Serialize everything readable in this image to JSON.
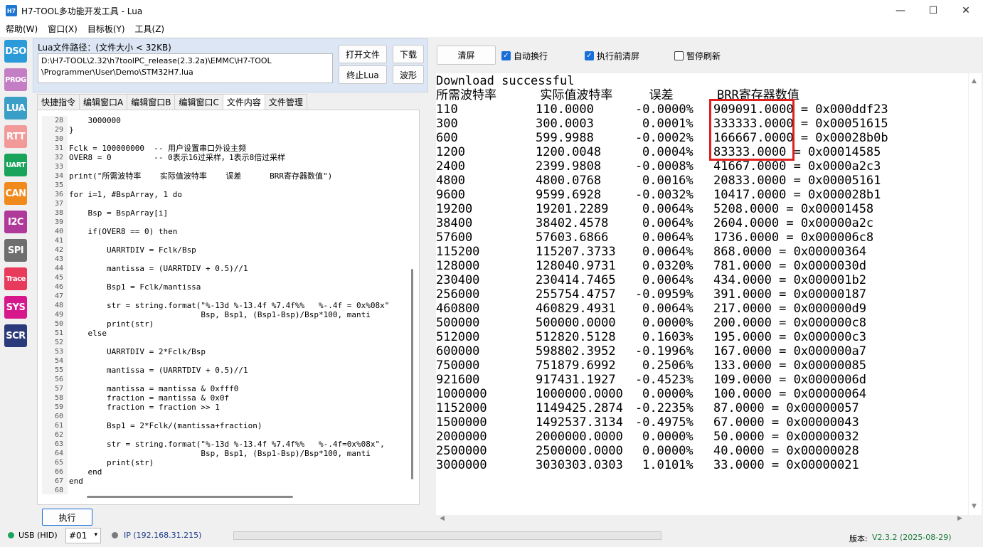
{
  "window": {
    "app_icon_text": "H7",
    "title": "H7-TOOL多功能开发工具 - Lua",
    "minimize": "—",
    "maximize": "☐",
    "close": "✕"
  },
  "menu": [
    "帮助(W)",
    "窗口(X)",
    "目标板(Y)",
    "工具(Z)"
  ],
  "tools": [
    {
      "label": "DSO",
      "color": "#2a9ad8"
    },
    {
      "label": "PROG",
      "color": "#c47ec4"
    },
    {
      "label": "LUA",
      "color": "#3a9ec6"
    },
    {
      "label": "RTT",
      "color": "#f29a9a"
    },
    {
      "label": "UART",
      "color": "#1aa35a"
    },
    {
      "label": "CAN",
      "color": "#f08a1c"
    },
    {
      "label": "I2C",
      "color": "#b03a9a"
    },
    {
      "label": "SPI",
      "color": "#6e6e6e"
    },
    {
      "label": "Trace",
      "color": "#e83a5a"
    },
    {
      "label": "SYS",
      "color": "#d6188c"
    },
    {
      "label": "SCR",
      "color": "#2a3a7a"
    }
  ],
  "lua_panel": {
    "path_label": "Lua文件路径：(文件大小 < 32KB)",
    "path_line1": "D:\\H7-TOOL\\2.32\\h7toolPC_release(2.3.2a)\\EMMC\\H7-TOOL",
    "path_line2": "\\Programmer\\User\\Demo\\STM32H7.lua",
    "open_btn": "打开文件",
    "download_btn": "下载",
    "stop_btn": "终止Lua",
    "wave_btn": "波形"
  },
  "tabs": [
    "快捷指令",
    "编辑窗口A",
    "编辑窗口B",
    "编辑窗口C",
    "文件内容",
    "文件管理"
  ],
  "active_tab": 4,
  "editor_lines": [
    {
      "n": "28",
      "t": "    3000000"
    },
    {
      "n": "29",
      "t": "}"
    },
    {
      "n": "30",
      "t": ""
    },
    {
      "n": "31",
      "t": "Fclk = 100000000  -- 用户设置串口外设主频"
    },
    {
      "n": "32",
      "t": "OVER8 = 0         -- 0表示16过采样，1表示8倍过采样"
    },
    {
      "n": "33",
      "t": ""
    },
    {
      "n": "34",
      "t": "print(\"所需波特率    实际值波特率    误差      BRR寄存器数值\")"
    },
    {
      "n": "35",
      "t": ""
    },
    {
      "n": "36",
      "t": "for i=1, #BspArray, 1 do"
    },
    {
      "n": "37",
      "t": ""
    },
    {
      "n": "38",
      "t": "    Bsp = BspArray[i]"
    },
    {
      "n": "39",
      "t": ""
    },
    {
      "n": "40",
      "t": "    if(OVER8 == 0) then"
    },
    {
      "n": "41",
      "t": ""
    },
    {
      "n": "42",
      "t": "        UARRTDIV = Fclk/Bsp"
    },
    {
      "n": "43",
      "t": ""
    },
    {
      "n": "44",
      "t": "        mantissa = (UARRTDIV + 0.5)//1"
    },
    {
      "n": "45",
      "t": ""
    },
    {
      "n": "46",
      "t": "        Bsp1 = Fclk/mantissa"
    },
    {
      "n": "47",
      "t": ""
    },
    {
      "n": "48",
      "t": "        str = string.format(\"%-13d %-13.4f %7.4f%%   %-.4f = 0x%08x\""
    },
    {
      "n": "49",
      "t": "                            Bsp, Bsp1, (Bsp1-Bsp)/Bsp*100, manti"
    },
    {
      "n": "50",
      "t": "        print(str)"
    },
    {
      "n": "51",
      "t": "    else"
    },
    {
      "n": "52",
      "t": ""
    },
    {
      "n": "53",
      "t": "        UARRTDIV = 2*Fclk/Bsp"
    },
    {
      "n": "54",
      "t": ""
    },
    {
      "n": "55",
      "t": "        mantissa = (UARRTDIV + 0.5)//1"
    },
    {
      "n": "56",
      "t": ""
    },
    {
      "n": "57",
      "t": "        mantissa = mantissa & 0xfff0"
    },
    {
      "n": "58",
      "t": "        fraction = mantissa & 0x0f"
    },
    {
      "n": "59",
      "t": "        fraction = fraction >> 1"
    },
    {
      "n": "60",
      "t": ""
    },
    {
      "n": "61",
      "t": "        Bsp1 = 2*Fclk/(mantissa+fraction)"
    },
    {
      "n": "62",
      "t": ""
    },
    {
      "n": "63",
      "t": "        str = string.format(\"%-13d %-13.4f %7.4f%%   %-.4f=0x%08x\","
    },
    {
      "n": "64",
      "t": "                            Bsp, Bsp1, (Bsp1-Bsp)/Bsp*100, manti"
    },
    {
      "n": "65",
      "t": "        print(str)"
    },
    {
      "n": "66",
      "t": "    end"
    },
    {
      "n": "67",
      "t": "end"
    },
    {
      "n": "68",
      "t": ""
    }
  ],
  "execute_btn": "执行",
  "output_toolbar": {
    "clear": "清屏",
    "auto_wrap": "自动换行",
    "clear_before_exec": "执行前清屏",
    "pause_refresh": "暂停刷新",
    "auto_wrap_checked": true,
    "clear_before_exec_checked": true,
    "pause_refresh_checked": false
  },
  "output_header": [
    "Download successful",
    "所需波特率      实际值波特率     误差      BRR寄存器数值"
  ],
  "output_rows": [
    [
      "110",
      "110.0000",
      "-0.0000%",
      "909091.0000 = 0x000ddf23"
    ],
    [
      "300",
      "300.0003",
      "0.0001%",
      "333333.0000 = 0x00051615"
    ],
    [
      "600",
      "599.9988",
      "-0.0002%",
      "166667.0000 = 0x00028b0b"
    ],
    [
      "1200",
      "1200.0048",
      "0.0004%",
      "83333.0000 = 0x00014585"
    ],
    [
      "2400",
      "2399.9808",
      "-0.0008%",
      "41667.0000 = 0x0000a2c3"
    ],
    [
      "4800",
      "4800.0768",
      "0.0016%",
      "20833.0000 = 0x00005161"
    ],
    [
      "9600",
      "9599.6928",
      "-0.0032%",
      "10417.0000 = 0x000028b1"
    ],
    [
      "19200",
      "19201.2289",
      "0.0064%",
      "5208.0000 = 0x00001458"
    ],
    [
      "38400",
      "38402.4578",
      "0.0064%",
      "2604.0000 = 0x00000a2c"
    ],
    [
      "57600",
      "57603.6866",
      "0.0064%",
      "1736.0000 = 0x000006c8"
    ],
    [
      "115200",
      "115207.3733",
      "0.0064%",
      "868.0000 = 0x00000364"
    ],
    [
      "128000",
      "128040.9731",
      "0.0320%",
      "781.0000 = 0x0000030d"
    ],
    [
      "230400",
      "230414.7465",
      "0.0064%",
      "434.0000 = 0x000001b2"
    ],
    [
      "256000",
      "255754.4757",
      "-0.0959%",
      "391.0000 = 0x00000187"
    ],
    [
      "460800",
      "460829.4931",
      "0.0064%",
      "217.0000 = 0x000000d9"
    ],
    [
      "500000",
      "500000.0000",
      "0.0000%",
      "200.0000 = 0x000000c8"
    ],
    [
      "512000",
      "512820.5128",
      "0.1603%",
      "195.0000 = 0x000000c3"
    ],
    [
      "600000",
      "598802.3952",
      "-0.1996%",
      "167.0000 = 0x000000a7"
    ],
    [
      "750000",
      "751879.6992",
      "0.2506%",
      "133.0000 = 0x00000085"
    ],
    [
      "921600",
      "917431.1927",
      "-0.4523%",
      "109.0000 = 0x0000006d"
    ],
    [
      "1000000",
      "1000000.0000",
      "0.0000%",
      "100.0000 = 0x00000064"
    ],
    [
      "1152000",
      "1149425.2874",
      "-0.2235%",
      "87.0000 = 0x00000057"
    ],
    [
      "1500000",
      "1492537.3134",
      "-0.4975%",
      "67.0000 = 0x00000043"
    ],
    [
      "2000000",
      "2000000.0000",
      "0.0000%",
      "50.0000 = 0x00000032"
    ],
    [
      "2500000",
      "2500000.0000",
      "0.0000%",
      "40.0000 = 0x00000028"
    ],
    [
      "3000000",
      "3030303.0303",
      "1.0101%",
      "33.0000 = 0x00000021"
    ]
  ],
  "status": {
    "usb": "USB (HID)",
    "device": "#01",
    "ip": "IP (192.168.31.215)",
    "version_label": "版本:",
    "version": "V2.3.2 (2025-08-29)",
    "usb_color": "#1aa35a",
    "ip_dot_color": "#7a7a7a"
  }
}
